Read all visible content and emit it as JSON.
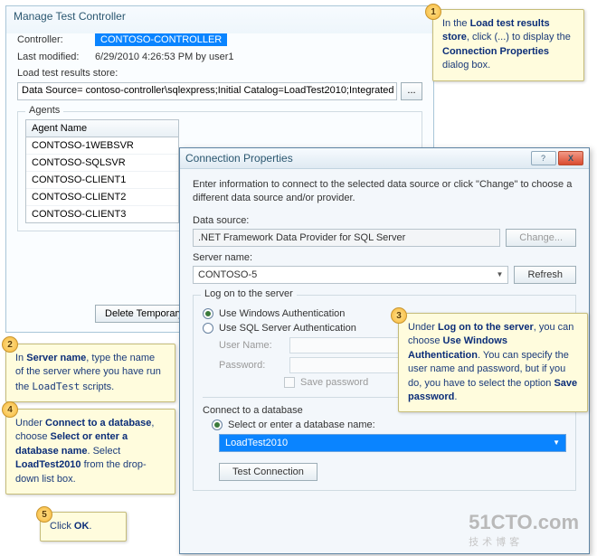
{
  "mainWindow": {
    "title": "Manage Test Controller",
    "controllerLabel": "Controller:",
    "controllerValue": "CONTOSO-CONTROLLER",
    "lastModifiedLabel": "Last modified:",
    "lastModifiedValue": "6/29/2010 4:26:53 PM by user1",
    "storeLabel": "Load test results store:",
    "storeValue": "Data Source= contoso-controller\\sqlexpress;Initial Catalog=LoadTest2010;Integrated Security",
    "ellipsis": "...",
    "agentsLegend": "Agents",
    "agentHeader": "Agent Name",
    "agents": [
      "CONTOSO-1WEBSVR",
      "CONTOSO-SQLSVR",
      "CONTOSO-CLIENT1",
      "CONTOSO-CLIENT2",
      "CONTOSO-CLIENT3"
    ],
    "deleteTemp": "Delete Temporary"
  },
  "dialog": {
    "title": "Connection Properties",
    "intro": "Enter information to connect to the selected data source or click \"Change\" to choose a different data source and/or provider.",
    "dataSourceLabel": "Data source:",
    "dataSourceValue": ".NET Framework Data Provider for SQL Server",
    "changeBtn": "Change...",
    "serverNameLabel": "Server name:",
    "serverNameValue": "CONTOSO-5",
    "refreshBtn": "Refresh",
    "logonLegend": "Log on to the server",
    "radioWin": "Use Windows Authentication",
    "radioSql": "Use SQL Server Authentication",
    "userLabel": "User Name:",
    "passLabel": "Password:",
    "savePass": "Save password",
    "connectDbLabel": "Connect to a database",
    "selectDbRadio": "Select or enter a database name:",
    "dbValue": "LoadTest2010",
    "testConn": "Test Connection",
    "closeX": "X"
  },
  "callouts": {
    "c1a": "In the ",
    "c1b": "Load test results store",
    "c1c": ", click (...) to display the ",
    "c1d": "Connection Properties",
    "c1e": " dialog box.",
    "c2a": "In ",
    "c2b": "Server name",
    "c2c": ", type the name of the server where you have run the ",
    "c2d": "LoadTest",
    "c2e": " scripts.",
    "c3a": "Under ",
    "c3b": "Log on to the server",
    "c3c": ", you can choose ",
    "c3d": "Use Windows Authentication",
    "c3e": ". You can specify the user name and password, but if you do, you have to select the option ",
    "c3f": "Save password",
    "c3g": ".",
    "c4a": "Under ",
    "c4b": "Connect to a database",
    "c4c": ", choose ",
    "c4d": "Select or enter a database name",
    "c4e": ". Select ",
    "c4f": "LoadTest2010",
    "c4g": " from the drop-down list box.",
    "c5a": "Click ",
    "c5b": "OK",
    "c5c": "."
  },
  "badges": {
    "n1": "1",
    "n2": "2",
    "n3": "3",
    "n4": "4",
    "n5": "5"
  },
  "watermark": {
    "main": "51CTO.com",
    "sub": "技术博客"
  }
}
